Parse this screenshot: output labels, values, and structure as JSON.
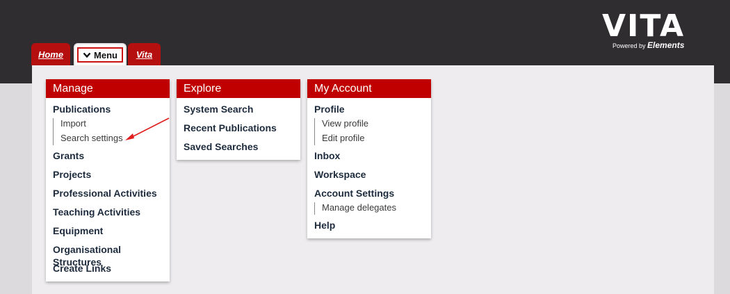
{
  "brand": {
    "name": "VITA",
    "powered_prefix": "Powered by",
    "powered_name": "Elements"
  },
  "tabs": {
    "home": "Home",
    "menu": "Menu",
    "vita": "Vita"
  },
  "colors": {
    "accent": "#c00000",
    "header_bg": "#302d31"
  },
  "manage": {
    "title": "Manage",
    "publications": "Publications",
    "publications_sub": [
      "Import",
      "Search settings"
    ],
    "items": [
      "Grants",
      "Projects",
      "Professional Activities",
      "Teaching Activities",
      "Equipment",
      "Organisational Structures",
      "Create Links"
    ]
  },
  "explore": {
    "title": "Explore",
    "items": [
      "System Search",
      "Recent Publications",
      "Saved Searches"
    ]
  },
  "account": {
    "title": "My Account",
    "profile": "Profile",
    "profile_sub": [
      "View profile",
      "Edit profile"
    ],
    "inbox": "Inbox",
    "workspace": "Workspace",
    "account_settings": "Account Settings",
    "account_settings_sub": [
      "Manage delegates"
    ],
    "help": "Help"
  }
}
